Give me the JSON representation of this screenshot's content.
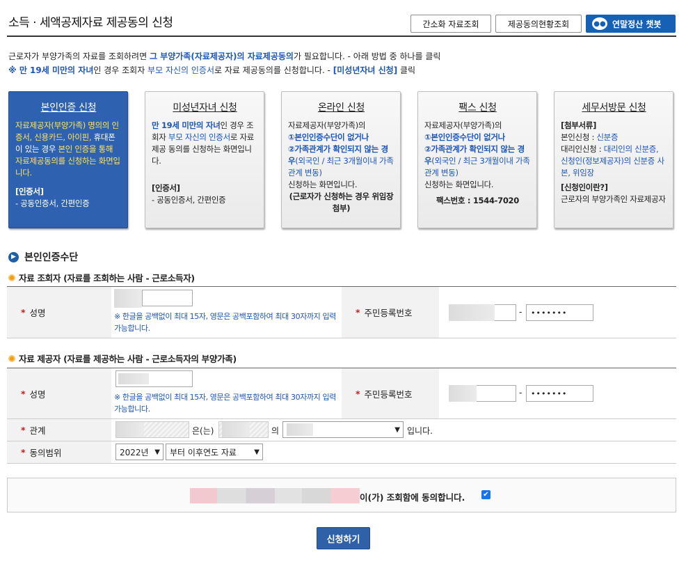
{
  "page": {
    "title": "소득 · 세액공제자료 제공동의 신청"
  },
  "top_buttons": {
    "simple": "간소화 자료조회",
    "consent_status": "제공동의현황조회",
    "chatbot": "연말정산 챗봇"
  },
  "intro": {
    "line1_a": "근로자가 부양가족의 자료를 조회하려면 ",
    "line1_b": "그 부양가족(자료제공자)의 자료제공동의",
    "line1_c": "가 필요합니다. - 아래 방법 중 하나를 클릭",
    "line2_a": "※ 만 19세 미만의 자녀",
    "line2_b": "인 경우 조회자 ",
    "line2_c": "부모 자신의 인증서",
    "line2_d": "로 자료 제공동의를 신청합니다. - ",
    "line2_e": "[미성년자녀 신청]",
    "line2_f": " 클릭"
  },
  "cards": {
    "c1": {
      "title": "본인인증 신청",
      "body_y": "자료제공자(부양가족) 명의의 인증서, 신용카드, 아이핀, ",
      "body_w": "휴대폰이 있는 경우",
      "body_y2": " 본인 인증을 통해 자료제공동의를 신청하는 화면입니다.",
      "cert_label": "[인증서]",
      "cert_value": "- 공동인증서, 간편인증"
    },
    "c2": {
      "title": "미성년자녀 신청",
      "a": "만 19세 미만의 자녀",
      "b": "인 경우 조회자 ",
      "c": "부모 자신의 인증서",
      "d": "로 자료 제공 동의를 신청하는 화면입니다.",
      "cert_label": "[인증서]",
      "cert_value": "- 공동인증서, 간편인증"
    },
    "c3": {
      "title": "온라인 신청",
      "a": "자료제공자(부양가족)의",
      "b": "①본인인증수단이 없거나",
      "c": "②가족관계가 확인되지 않는 경우",
      "d": "(외국인 / 최근 3개월이내 가족관계 변동)",
      "e": "신청하는 화면입니다.",
      "f": "(근로자가 신청하는 경우 위임장 첨부)"
    },
    "c4": {
      "title": "팩스 신청",
      "a": "자료제공자(부양가족)의",
      "b": "①본인인증수단이 없거나",
      "c": "②가족관계가 확인되지 않는 경우",
      "d": "(외국인 / 최근 3개월이내 가족관계 변동)",
      "e": "신청하는 화면입니다.",
      "fax": "팩스번호 : 1544-7020"
    },
    "c5": {
      "title": "세무서방문 신청",
      "docs_label": "[첨부서류]",
      "self": "본인신청 : ",
      "self_v": "신분증",
      "proxy": "대리인신청 : ",
      "proxy_v": "대리인의 신분증, 신청인(정보제공자)의 신분증 사본, 위임장",
      "who_label": "[신청인이란?]",
      "who_v": "근로자의 부양가족인 자료제공자"
    }
  },
  "auth_section": {
    "title": "본인인증수단"
  },
  "inquirer": {
    "title": "자료 조회자 (자료를 조회하는 사람 - 근로소득자)",
    "name_label": "성명",
    "note": "※ 한글을 공백없이 최대 15자, 영문은 공백포함하여 최대 30자까지 입력가능합니다.",
    "rrn_label": "주민등록번호",
    "rrn_back": "•••••••"
  },
  "provider": {
    "title": "자료 제공자 (자료를 제공하는 사람 - 근로소득자의 부양가족)",
    "name_label": "성명",
    "note": "※ 한글을 공백없이 최대 15자, 영문은 공백포함하여 최대 30자까지 입력가능합니다.",
    "rrn_label": "주민등록번호",
    "rrn_back": "•••••••",
    "relation_label": "관계",
    "relation_eun": "은(는)",
    "relation_ui": "의",
    "relation_end": "입니다.",
    "range_label": "동의범위",
    "year": "2022년",
    "range": "부터 이후연도 자료"
  },
  "agree": {
    "text": "이(가) 조회함에 동의합니다.",
    "checked": true
  },
  "submit": "신청하기"
}
